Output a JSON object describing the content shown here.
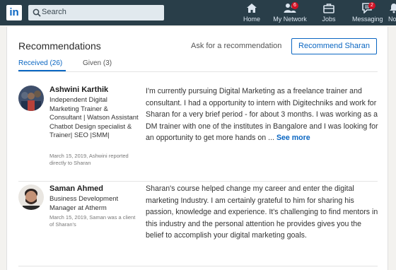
{
  "nav": {
    "logo": "in",
    "search_placeholder": "Search",
    "items": [
      {
        "label": "Home",
        "badge": ""
      },
      {
        "label": "My Network",
        "badge": "6"
      },
      {
        "label": "Jobs",
        "badge": ""
      },
      {
        "label": "Messaging",
        "badge": "2"
      },
      {
        "label": "No",
        "badge": ""
      }
    ]
  },
  "card": {
    "title": "Recommendations",
    "ask_link": "Ask for a recommendation",
    "recommend_button": "Recommend Sharan",
    "tabs": [
      {
        "label": "Received (26)",
        "active": true
      },
      {
        "label": "Given (3)",
        "active": false
      }
    ]
  },
  "recommendations": [
    {
      "name": "Ashwini Karthik",
      "title": "Independent Digital Marketing Trainer & Consultant | Watson Assistant Chatbot Design specialist & Trainer| SEO |SMM|",
      "meta": "March 15, 2019, Ashwini reported directly to Sharan",
      "text": "I'm currently pursuing Digital Marketing as a freelance trainer and consultant. I had a opportunity to intern with Digitechniks and work for Sharan for a very brief period - for about 3 months. I was working as a DM trainer with one of the institutes in Bangalore and I was looking for an opportunity to get more hands on ...",
      "see_more": "See more"
    },
    {
      "name": "Saman Ahmed",
      "title": "Business Development Manager at Atherm",
      "meta": "March 15, 2019, Saman was a client of Sharan's",
      "text": "Sharan's course helped change my career and enter the digital marketing Industry. I am certainly grateful to him for sharing his passion, knowledge and experience. It's challenging to find mentors in this industry and the personal attention he provides gives you the belief to accomplish your digital marketing goals."
    }
  ],
  "colors": {
    "nav_bg": "#293e49",
    "accent": "#0a66c2",
    "badge": "#d11124"
  }
}
